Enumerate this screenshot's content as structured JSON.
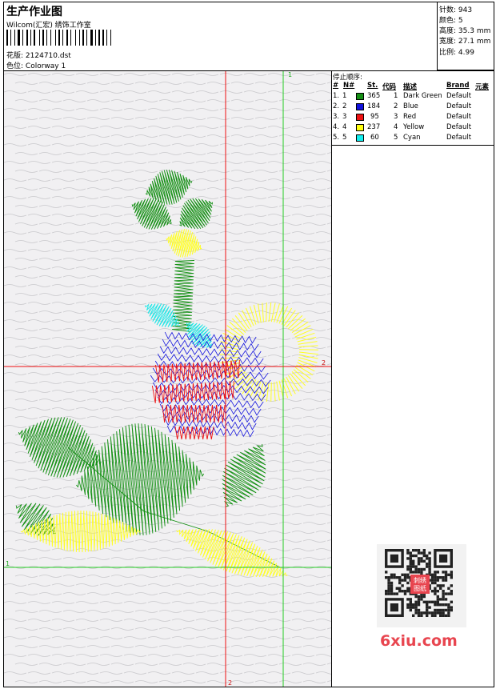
{
  "header": {
    "title": "生产作业图",
    "software": "Wilcom(汇宏) 绣饰工作室",
    "design_label": "花版:",
    "design_file": "2124710.dst",
    "colorway_label": "色位:",
    "colorway": "Colorway 1"
  },
  "stats": {
    "stitches_label": "针数:",
    "stitches": "943",
    "colors_label": "颜色:",
    "colors": "5",
    "height_label": "高度:",
    "height": "35.3 mm",
    "width_label": "宽度:",
    "width": "27.1 mm",
    "scale_label": "比例:",
    "scale": "4.99"
  },
  "legend": {
    "title": "停止顺序:",
    "headers": {
      "stop": "#",
      "needle": "N#",
      "stitches": "St.",
      "code": "代码",
      "description": "描述",
      "brand": "Brand",
      "element": "元素"
    },
    "rows": [
      {
        "stop": "1.",
        "needle": "1",
        "color": "#148f14",
        "stitches": "365",
        "code": "1",
        "description": "Dark Green",
        "brand": "Default"
      },
      {
        "stop": "2.",
        "needle": "2",
        "color": "#1111dd",
        "stitches": "184",
        "code": "2",
        "description": "Blue",
        "brand": "Default"
      },
      {
        "stop": "3.",
        "needle": "3",
        "color": "#ee1111",
        "stitches": "95",
        "code": "3",
        "description": "Red",
        "brand": "Default"
      },
      {
        "stop": "4.",
        "needle": "4",
        "color": "#ffff11",
        "stitches": "237",
        "code": "4",
        "description": "Yellow",
        "brand": "Default"
      },
      {
        "stop": "5.",
        "needle": "5",
        "color": "#11eeee",
        "stitches": "60",
        "code": "5",
        "description": "Cyan",
        "brand": "Default"
      }
    ]
  },
  "guides": {
    "green_label_top": "1",
    "green_label_left": "1",
    "red_label_right": "2",
    "red_label_bottom": "2"
  },
  "watermark": "6xiu.com",
  "qr_stamp": "刺绣图纸"
}
